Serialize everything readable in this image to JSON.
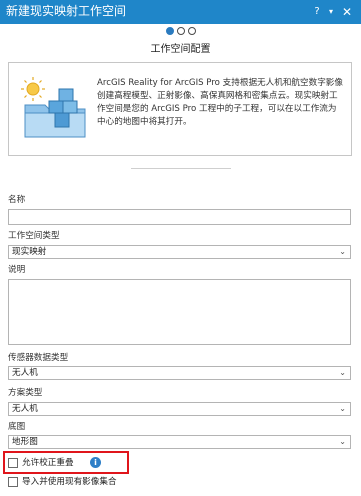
{
  "window": {
    "title": "新建现实映射工作空间",
    "help": "?",
    "menu": "▾",
    "close": "✕"
  },
  "wizard": {
    "steps_total": 3,
    "current_step": 1,
    "page_title": "工作空间配置"
  },
  "info": {
    "description": "ArcGIS Reality for ArcGIS Pro 支持根据无人机和航空数字影像创建高程模型、正射影像、高保真网格和密集点云。现实映射工作空间是您的 ArcGIS Pro 工程中的子工程，可以在以工作流为中心的地图中将其打开。"
  },
  "form": {
    "name": {
      "label": "名称",
      "value": ""
    },
    "workspace_type": {
      "label": "工作空间类型",
      "value": "现实映射"
    },
    "description": {
      "label": "说明",
      "value": ""
    },
    "sensor_type": {
      "label": "传感器数据类型",
      "value": "无人机"
    },
    "scenario_type": {
      "label": "方案类型",
      "value": "无人机"
    },
    "basemap": {
      "label": "底图",
      "value": "地形图"
    },
    "allow_adjust_overlap": {
      "label": "允许校正重叠",
      "checked": false
    },
    "import_existing_collection": {
      "label": "导入并使用现有影像集合",
      "checked": false
    }
  },
  "colors": {
    "titlebar": "#1f86c9",
    "accent": "#2b7bbf",
    "highlight_border": "#e0151b"
  },
  "icons": {
    "chevron": "chevron-down-icon",
    "info": "info-icon"
  }
}
